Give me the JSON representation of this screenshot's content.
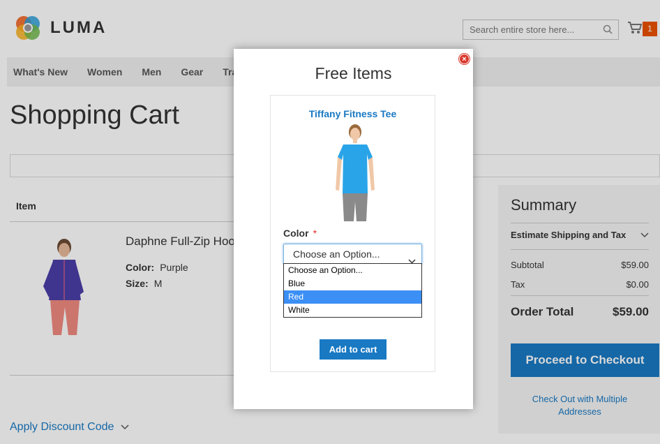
{
  "brand": {
    "name": "LUMA"
  },
  "search": {
    "placeholder": "Search entire store here..."
  },
  "cart": {
    "count": "1"
  },
  "nav": {
    "items": [
      "What's New",
      "Women",
      "Men",
      "Gear",
      "Tra"
    ]
  },
  "page": {
    "title": "Shopping Cart"
  },
  "cart_table": {
    "item_header": "Item"
  },
  "product": {
    "name": "Daphne Full-Zip Hoo",
    "color_label": "Color:",
    "color_value": "Purple",
    "size_label": "Size:",
    "size_value": "M"
  },
  "discount": {
    "label": "Apply Discount Code"
  },
  "summary": {
    "title": "Summary",
    "estimate_label": "Estimate Shipping and Tax",
    "subtotal_label": "Subtotal",
    "subtotal_value": "$59.00",
    "tax_label": "Tax",
    "tax_value": "$0.00",
    "total_label": "Order Total",
    "total_value": "$59.00",
    "checkout_label": "Proceed to Checkout",
    "multi_line1": "Check Out with Multiple",
    "multi_line2": "Addresses"
  },
  "modal": {
    "title": "Free Items",
    "item_name": "Tiffany Fitness Tee",
    "option_label": "Color",
    "required_mark": "*",
    "select_value": "Choose an Option...",
    "options": [
      "Choose an Option...",
      "Blue",
      "Red",
      "White"
    ],
    "highlighted_option": "Red",
    "add_to_cart_label": "Add to cart",
    "close_glyph": "×"
  },
  "colors": {
    "accent": "#1979c3",
    "cart_badge": "#eb5202",
    "highlight": "#3b8ff5"
  }
}
